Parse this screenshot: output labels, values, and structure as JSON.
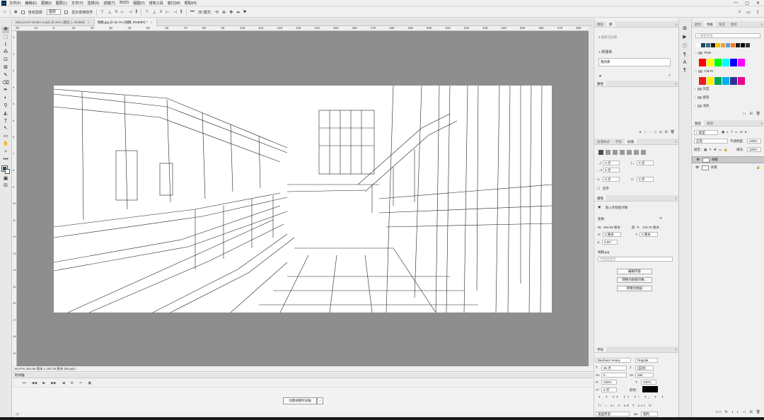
{
  "menubar": {
    "logo": "Ps",
    "items": [
      "文件(F)",
      "编辑(E)",
      "图像(I)",
      "图层(L)",
      "文字(Y)",
      "选择(S)",
      "滤镜(T)",
      "3D(D)",
      "视图(V)",
      "增效工具",
      "窗口(W)",
      "帮助(H)"
    ],
    "win_min": "—",
    "win_max": "▢",
    "win_close": "✕"
  },
  "options": {
    "home_icon": "⌂",
    "move_icon": "✥",
    "auto_select_label": "自动选择:",
    "auto_select_value": "图层",
    "show_transform_label": "显示变换控件",
    "align_icons": [
      "⊤",
      "⊥",
      "≡",
      "⊢",
      "⊣",
      "⫼"
    ],
    "dist_icons": [
      "⊤",
      "⊥",
      "≡",
      "⊢",
      "⊣",
      "⫼"
    ],
    "more": "•••",
    "mode_3d_label": "3D 模式:",
    "mode_3d_icons": [
      "⟲",
      "⊕",
      "✥",
      "⇹",
      "■"
    ],
    "right_icons": [
      "⌕",
      "▭",
      "⇪"
    ]
  },
  "tools": [
    "✥",
    "⬚",
    "ℓ",
    "⁂",
    "⊡",
    "⊠",
    "✎",
    "⌫",
    "✒",
    "◐",
    "⚲",
    "◭",
    "T",
    "↖",
    "▭",
    "✋",
    "⌕",
    "•••"
  ],
  "tools_after": [
    "▣",
    "⊟"
  ],
  "doctabs": [
    {
      "label": "MOLCHAT DOMA-4.psb @ 25% (图层 1, RGB/8)",
      "close": "×",
      "active": false
    },
    {
      "label": "线稿.jpg @ 16.7% (线稿, RGB/8#) *",
      "close": "×",
      "active": true
    }
  ],
  "hruler": [
    "20",
    "10",
    "0",
    "10",
    "20",
    "30",
    "40",
    "50",
    "60",
    "70",
    "80",
    "90",
    "100",
    "110",
    "120",
    "130",
    "140",
    "150",
    "160",
    "170",
    "180",
    "190",
    "200",
    "210",
    "220",
    "230",
    "240",
    "250",
    "260",
    "270",
    "280"
  ],
  "vruler": [
    "0",
    "1",
    "2",
    "3",
    "4",
    "5",
    "6",
    "7",
    "8",
    "9",
    "10",
    "11",
    "12",
    "13",
    "14",
    "15",
    "16",
    "17",
    "18",
    "19"
  ],
  "status": "16.67%  264.56 厘米 x 120.78 厘米 (56 ppi)   ›",
  "timeline": {
    "title": "时间轴",
    "ctrl_icons": [
      "⏮",
      "◀◀",
      "▶",
      "▶▶",
      "◀",
      "⚙",
      "✂",
      "▣"
    ],
    "create_button": "创建视频时间轴",
    "dropdown": "⌵",
    "foot": "◁▷"
  },
  "mid": {
    "lib_tabs": [
      "模板",
      "库"
    ],
    "search_placeholder": "搜索当前库",
    "new_library": "+ 新建库",
    "library_item": "我的库",
    "paths_tab": "路径",
    "para_tabs": [
      "段落样式",
      "字符",
      "段落"
    ],
    "para_fields": [
      {
        "icon": "→|",
        "value": "0 点"
      },
      {
        "icon": "|←",
        "value": "0 点"
      },
      {
        "icon": "→≡",
        "value": "0 点"
      },
      {
        "icon": "≡↓",
        "value": "0 点"
      },
      {
        "icon": "≡↑",
        "value": "0 点"
      }
    ],
    "hyphen_label": "连字",
    "props_tab": "属性",
    "smart_object": "嵌入的智能对象",
    "transform_label": "变换",
    "w_label": "W:",
    "w_value": "264.56 厘米",
    "h_label": "H:",
    "h_value": "120.78 厘米",
    "x_label": "X:",
    "x_value": "0 厘米",
    "y_label": "Y:",
    "y_value": "0 厘米",
    "angle_value": "0.00°",
    "file_label": "线稿.jpg",
    "layer_comp": "无图层复合",
    "buttons": [
      "编辑内容",
      "转换为链接对象...",
      "转换为图层"
    ],
    "char_tab": "字符",
    "font_family": "Bauhaus Heavy",
    "font_style": "Regular",
    "font_size": "36 点",
    "leading": "(自动)",
    "kerning": "0",
    "tracking": "280",
    "vscale": "100%",
    "hscale": "100%",
    "baseline": "0 点",
    "color_label": "颜色:",
    "text_color": "#000000",
    "type_styles": [
      "T",
      "T",
      "TT",
      "Tт",
      "T¹",
      "T₁",
      "T",
      "T"
    ],
    "opentype": [
      "fi",
      "ℴ",
      "st",
      "A",
      "ad",
      "T",
      "1st",
      "½"
    ],
    "language": "美国英语",
    "aa": "锐利"
  },
  "iconcol": [
    "⊞",
    "▶",
    "ⓘ",
    "¶",
    "A",
    "¶"
  ],
  "right": {
    "swatch_tabs": [
      "颜色",
      "色板",
      "渐变",
      "图案"
    ],
    "swatch_search": "搜索色板",
    "recent_colors": [
      "#ffffff",
      "#1c4a63",
      "#3a6d8a",
      "#1c1c1c",
      "#f4c400",
      "#f0a23c",
      "#5b9bd5",
      "#e87c2a",
      "#1c1c1c",
      "#000000",
      "#333333"
    ],
    "group_rgb": "RGB",
    "rgb_colors": [
      "#ff0000",
      "#ffff00",
      "#00ff00",
      "#00ffff",
      "#0000ff",
      "#ff00ff"
    ],
    "group_cmyk": "CMYK",
    "cmyk_colors": [
      "#ed1c24",
      "#fff200",
      "#00a651",
      "#00aeef",
      "#2e3192",
      "#ec008c"
    ],
    "groups": [
      "灰度",
      "蜡笔",
      "浅色"
    ],
    "layer_tabs": [
      "图层",
      "通道"
    ],
    "kind_label": "类型",
    "blend": "正常",
    "opacity_label": "不透明度:",
    "opacity": "100%",
    "lock_label": "锁定:",
    "fill_label": "填充:",
    "fill": "100%",
    "layers": [
      {
        "name": "线稿",
        "selected": true,
        "lock": ""
      },
      {
        "name": "背景",
        "selected": false,
        "lock": "🔒"
      }
    ],
    "foot_icons": [
      "⊂⊃",
      "fx",
      "◑",
      "◐",
      "▭",
      "⊞",
      "🗑"
    ]
  }
}
